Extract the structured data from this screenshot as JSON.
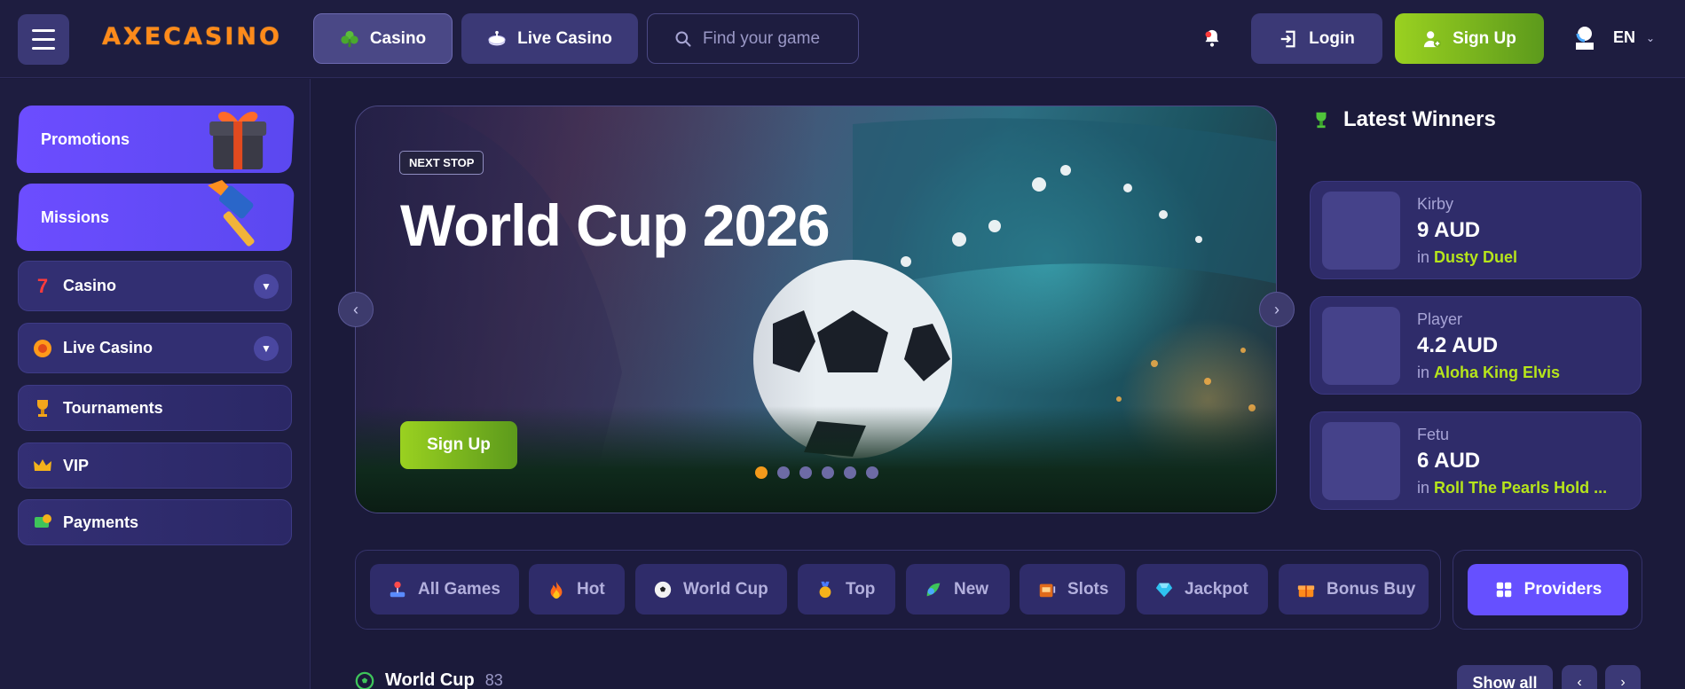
{
  "header": {
    "logo": "AXECASINO",
    "nav": {
      "casino": "Casino",
      "live_casino": "Live Casino"
    },
    "search_placeholder": "Find your game",
    "login": "Login",
    "signup": "Sign Up",
    "language": "EN"
  },
  "sidebar": {
    "promotions": "Promotions",
    "missions": "Missions",
    "items": [
      {
        "label": "Casino",
        "icon": "seven-icon",
        "expandable": true
      },
      {
        "label": "Live Casino",
        "icon": "chip-icon",
        "expandable": true
      },
      {
        "label": "Tournaments",
        "icon": "trophy-icon",
        "expandable": false
      },
      {
        "label": "VIP",
        "icon": "crown-icon",
        "expandable": false
      },
      {
        "label": "Payments",
        "icon": "money-icon",
        "expandable": false
      }
    ]
  },
  "banner": {
    "tag": "NEXT STOP",
    "title": "World Cup 2026",
    "cta": "Sign Up",
    "slides": 6,
    "active_slide": 1
  },
  "winners": {
    "title": "Latest Winners",
    "in_label": "in",
    "items": [
      {
        "name": "Kirby",
        "amount": "9 AUD",
        "game": "Dusty Duel"
      },
      {
        "name": "Player",
        "amount": "4.2 AUD",
        "game": "Aloha King Elvis"
      },
      {
        "name": "Fetu",
        "amount": "6 AUD",
        "game": "Roll The Pearls Hold ..."
      }
    ]
  },
  "categories": [
    {
      "label": "All Games",
      "icon": "joystick-icon"
    },
    {
      "label": "Hot",
      "icon": "fire-icon"
    },
    {
      "label": "World Cup",
      "icon": "soccer-ball-icon"
    },
    {
      "label": "Top",
      "icon": "medal-icon"
    },
    {
      "label": "New",
      "icon": "new-icon"
    },
    {
      "label": "Slots",
      "icon": "slot-icon"
    },
    {
      "label": "Jackpot",
      "icon": "diamond-icon"
    },
    {
      "label": "Bonus Buy",
      "icon": "gift-icon"
    }
  ],
  "providers": "Providers",
  "section": {
    "title": "World Cup",
    "count": "83",
    "show_all": "Show all"
  },
  "colors": {
    "background": "#1b1a3a",
    "accent_purple": "#6650ff",
    "accent_green": "#9ad120",
    "winner_game": "#b6e51b",
    "active_dot": "#f39a1b"
  }
}
